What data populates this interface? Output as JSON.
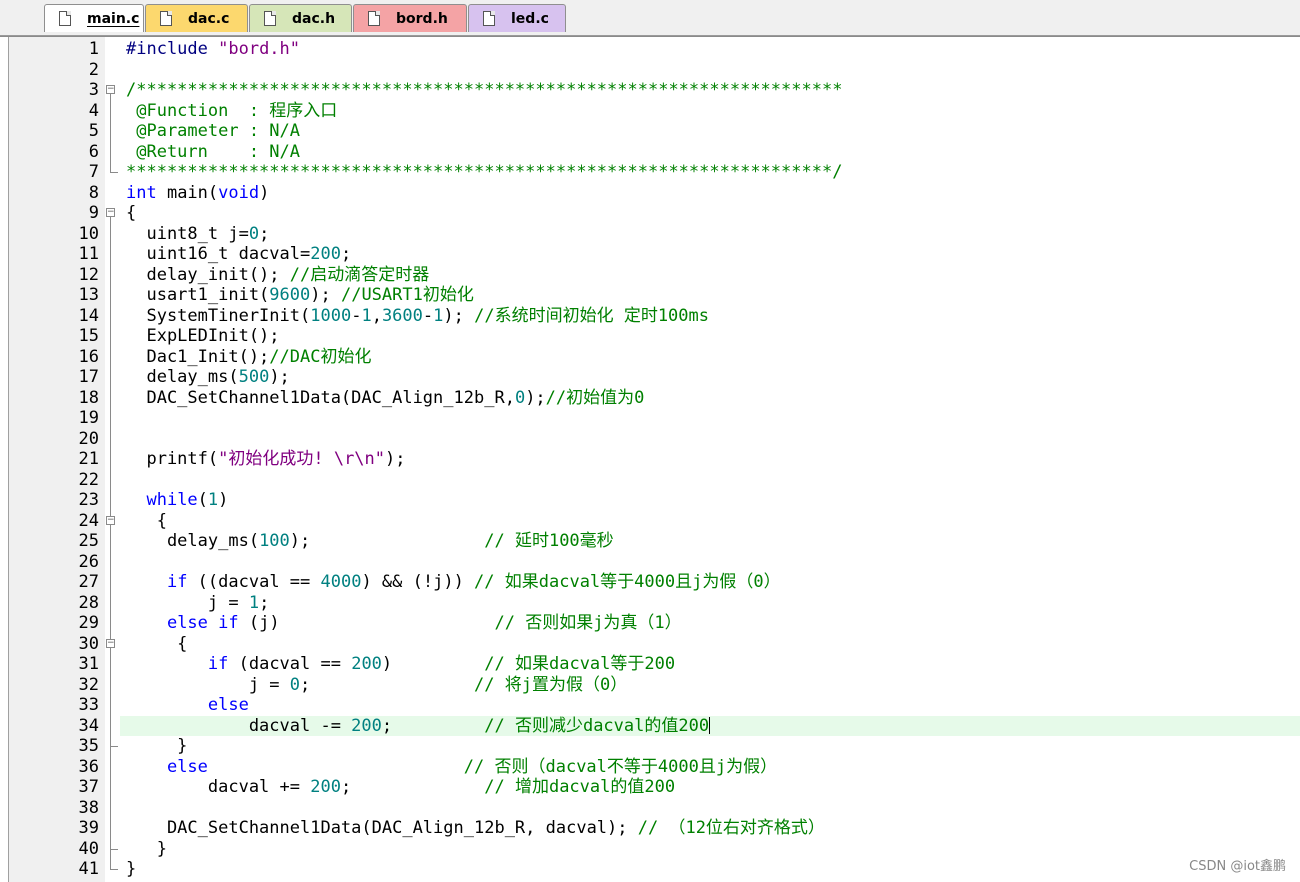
{
  "tabs": [
    {
      "label": "main.c",
      "active": true,
      "color": "#ffffff"
    },
    {
      "label": "dac.c",
      "active": false,
      "color": "#fcd86e"
    },
    {
      "label": "dac.h",
      "active": false,
      "color": "#d6e6b8"
    },
    {
      "label": "bord.h",
      "active": false,
      "color": "#f4a3a5"
    },
    {
      "label": "led.c",
      "active": false,
      "color": "#d7c2ef"
    }
  ],
  "editor": {
    "current_line": 34,
    "lines": [
      {
        "n": "1",
        "tokens": [
          {
            "t": "#include ",
            "c": "pp"
          },
          {
            "t": "\"bord.h\"",
            "c": "str"
          }
        ]
      },
      {
        "n": "2",
        "tokens": []
      },
      {
        "n": "3",
        "tokens": [
          {
            "t": "/*********************************************************************",
            "c": "cmt"
          }
        ]
      },
      {
        "n": "4",
        "tokens": [
          {
            "t": " @Function  : 程序入口",
            "c": "cmt"
          }
        ]
      },
      {
        "n": "5",
        "tokens": [
          {
            "t": " @Parameter : N/A",
            "c": "cmt"
          }
        ]
      },
      {
        "n": "6",
        "tokens": [
          {
            "t": " @Return    : N/A",
            "c": "cmt"
          }
        ]
      },
      {
        "n": "7",
        "tokens": [
          {
            "t": "*********************************************************************/",
            "c": "cmt"
          }
        ]
      },
      {
        "n": "8",
        "tokens": [
          {
            "t": "int",
            "c": "kw"
          },
          {
            "t": " main(",
            "c": ""
          },
          {
            "t": "void",
            "c": "kw"
          },
          {
            "t": ")",
            "c": ""
          }
        ]
      },
      {
        "n": "9",
        "tokens": [
          {
            "t": "{",
            "c": ""
          }
        ]
      },
      {
        "n": "10",
        "tokens": [
          {
            "t": "  uint8_t j=",
            "c": ""
          },
          {
            "t": "0",
            "c": "num"
          },
          {
            "t": ";",
            "c": ""
          }
        ]
      },
      {
        "n": "11",
        "tokens": [
          {
            "t": "  uint16_t dacval=",
            "c": ""
          },
          {
            "t": "200",
            "c": "num"
          },
          {
            "t": ";",
            "c": ""
          }
        ]
      },
      {
        "n": "12",
        "tokens": [
          {
            "t": "  delay_init(); ",
            "c": ""
          },
          {
            "t": "//启动滴答定时器",
            "c": "cmt"
          }
        ]
      },
      {
        "n": "13",
        "tokens": [
          {
            "t": "  usart1_init(",
            "c": ""
          },
          {
            "t": "9600",
            "c": "num"
          },
          {
            "t": "); ",
            "c": ""
          },
          {
            "t": "//USART1初始化",
            "c": "cmt"
          }
        ]
      },
      {
        "n": "14",
        "tokens": [
          {
            "t": "  SystemTinerInit(",
            "c": ""
          },
          {
            "t": "1000",
            "c": "num"
          },
          {
            "t": "-",
            "c": ""
          },
          {
            "t": "1",
            "c": "num"
          },
          {
            "t": ",",
            "c": ""
          },
          {
            "t": "3600",
            "c": "num"
          },
          {
            "t": "-",
            "c": ""
          },
          {
            "t": "1",
            "c": "num"
          },
          {
            "t": "); ",
            "c": ""
          },
          {
            "t": "//系统时间初始化 定时100ms",
            "c": "cmt"
          }
        ]
      },
      {
        "n": "15",
        "tokens": [
          {
            "t": "  ExpLEDInit();",
            "c": ""
          }
        ]
      },
      {
        "n": "16",
        "tokens": [
          {
            "t": "  Dac1_Init();",
            "c": ""
          },
          {
            "t": "//DAC初始化",
            "c": "cmt"
          }
        ]
      },
      {
        "n": "17",
        "tokens": [
          {
            "t": "  delay_ms(",
            "c": ""
          },
          {
            "t": "500",
            "c": "num"
          },
          {
            "t": ");",
            "c": ""
          }
        ]
      },
      {
        "n": "18",
        "tokens": [
          {
            "t": "  DAC_SetChannel1Data(DAC_Align_12b_R,",
            "c": ""
          },
          {
            "t": "0",
            "c": "num"
          },
          {
            "t": ");",
            "c": ""
          },
          {
            "t": "//初始值为0",
            "c": "cmt"
          }
        ]
      },
      {
        "n": "19",
        "tokens": []
      },
      {
        "n": "20",
        "tokens": []
      },
      {
        "n": "21",
        "tokens": [
          {
            "t": "  printf(",
            "c": ""
          },
          {
            "t": "\"初始化成功! \\r\\n\"",
            "c": "str"
          },
          {
            "t": ");",
            "c": ""
          }
        ]
      },
      {
        "n": "22",
        "tokens": []
      },
      {
        "n": "23",
        "tokens": [
          {
            "t": "  ",
            "c": ""
          },
          {
            "t": "while",
            "c": "kw"
          },
          {
            "t": "(",
            "c": ""
          },
          {
            "t": "1",
            "c": "num"
          },
          {
            "t": ")",
            "c": ""
          }
        ]
      },
      {
        "n": "24",
        "tokens": [
          {
            "t": "   {",
            "c": ""
          }
        ]
      },
      {
        "n": "25",
        "tokens": [
          {
            "t": "    delay_ms(",
            "c": ""
          },
          {
            "t": "100",
            "c": "num"
          },
          {
            "t": ");                 ",
            "c": ""
          },
          {
            "t": "// 延时100毫秒",
            "c": "cmt"
          }
        ]
      },
      {
        "n": "26",
        "tokens": []
      },
      {
        "n": "27",
        "tokens": [
          {
            "t": "    ",
            "c": ""
          },
          {
            "t": "if",
            "c": "kw"
          },
          {
            "t": " ((dacval == ",
            "c": ""
          },
          {
            "t": "4000",
            "c": "num"
          },
          {
            "t": ") && (!j)) ",
            "c": ""
          },
          {
            "t": "// 如果dacval等于4000且j为假（0）",
            "c": "cmt"
          }
        ]
      },
      {
        "n": "28",
        "tokens": [
          {
            "t": "        j = ",
            "c": ""
          },
          {
            "t": "1",
            "c": "num"
          },
          {
            "t": ";",
            "c": ""
          }
        ]
      },
      {
        "n": "29",
        "tokens": [
          {
            "t": "    ",
            "c": ""
          },
          {
            "t": "else if",
            "c": "kw"
          },
          {
            "t": " (j)                     ",
            "c": ""
          },
          {
            "t": "// 否则如果j为真（1）",
            "c": "cmt"
          }
        ]
      },
      {
        "n": "30",
        "tokens": [
          {
            "t": "     {",
            "c": ""
          }
        ]
      },
      {
        "n": "31",
        "tokens": [
          {
            "t": "        ",
            "c": ""
          },
          {
            "t": "if",
            "c": "kw"
          },
          {
            "t": " (dacval == ",
            "c": ""
          },
          {
            "t": "200",
            "c": "num"
          },
          {
            "t": ")         ",
            "c": ""
          },
          {
            "t": "// 如果dacval等于200",
            "c": "cmt"
          }
        ]
      },
      {
        "n": "32",
        "tokens": [
          {
            "t": "            j = ",
            "c": ""
          },
          {
            "t": "0",
            "c": "num"
          },
          {
            "t": ";                ",
            "c": ""
          },
          {
            "t": "// 将j置为假（0）",
            "c": "cmt"
          }
        ]
      },
      {
        "n": "33",
        "tokens": [
          {
            "t": "        ",
            "c": ""
          },
          {
            "t": "else",
            "c": "kw"
          }
        ]
      },
      {
        "n": "34",
        "tokens": [
          {
            "t": "            dacval -= ",
            "c": ""
          },
          {
            "t": "200",
            "c": "num"
          },
          {
            "t": ";         ",
            "c": ""
          },
          {
            "t": "// 否则减少dacval的值200",
            "c": "cmt"
          }
        ]
      },
      {
        "n": "35",
        "tokens": [
          {
            "t": "     }",
            "c": ""
          }
        ]
      },
      {
        "n": "36",
        "tokens": [
          {
            "t": "    ",
            "c": ""
          },
          {
            "t": "else",
            "c": "kw"
          },
          {
            "t": "                         ",
            "c": ""
          },
          {
            "t": "// 否则（dacval不等于4000且j为假）",
            "c": "cmt"
          }
        ]
      },
      {
        "n": "37",
        "tokens": [
          {
            "t": "        dacval += ",
            "c": ""
          },
          {
            "t": "200",
            "c": "num"
          },
          {
            "t": ";             ",
            "c": ""
          },
          {
            "t": "// 增加dacval的值200",
            "c": "cmt"
          }
        ]
      },
      {
        "n": "38",
        "tokens": []
      },
      {
        "n": "39",
        "tokens": [
          {
            "t": "    DAC_SetChannel1Data(DAC_Align_12b_R, dacval); ",
            "c": ""
          },
          {
            "t": "// （12位右对齐格式）",
            "c": "cmt"
          }
        ]
      },
      {
        "n": "40",
        "tokens": [
          {
            "t": "   }",
            "c": ""
          }
        ]
      },
      {
        "n": "41",
        "tokens": [
          {
            "t": "}",
            "c": ""
          }
        ]
      }
    ]
  },
  "watermark": "CSDN @iot鑫鹏"
}
